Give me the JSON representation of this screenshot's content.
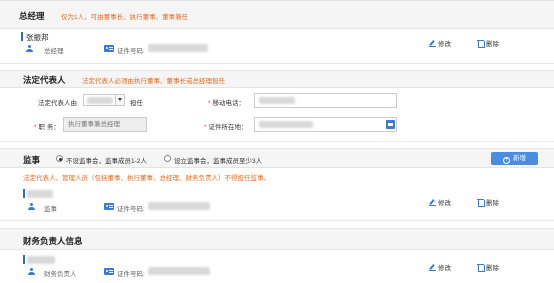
{
  "general_manager": {
    "title": "总经理",
    "hint": "仅为1人，可由董事长、执行董事、董事兼任",
    "person_name": "张振邦",
    "role": "总经理",
    "id_label": "证件号码:",
    "edit_label": "修改",
    "delete_label": "删除"
  },
  "legal_rep": {
    "title": "法定代表人",
    "hint": "法定代表人必须由执行董事、董事长或总经理担任",
    "served_by_label": "法定代表人由",
    "served_by_suffix": "担任",
    "mobile_label": "移动电话：",
    "position_label": "职  务：",
    "position_value": "执行董事兼总经理",
    "id_location_label": "证件所在地："
  },
  "supervisor": {
    "title": "监事",
    "options": [
      "不设监事会，监事成员1-2人",
      "设立监事会，监事成员至少3人"
    ],
    "add_label": "新增",
    "hint": "法定代表人、管理人员（包括董事、执行董事、总经理、财务负责人）不得担任监事。",
    "role": "监事",
    "id_label": "证件号码:",
    "edit_label": "修改",
    "delete_label": "删除"
  },
  "finance": {
    "title": "财务负责人信息",
    "role": "财务负责人",
    "id_label": "证件号码:",
    "edit_label": "修改",
    "delete_label": "删除"
  },
  "colors": {
    "accent": "#3a7bd5",
    "warning": "#f06a1c",
    "required": "#e33333"
  }
}
